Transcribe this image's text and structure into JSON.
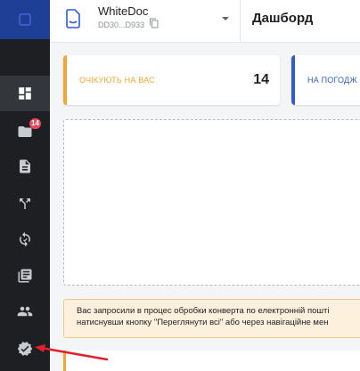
{
  "sidebar": {
    "items": [
      {
        "icon": "dashboard-icon",
        "active": true
      },
      {
        "icon": "folder-icon",
        "badge": "14"
      },
      {
        "icon": "document-icon"
      },
      {
        "icon": "route-icon"
      },
      {
        "icon": "sync-icon"
      },
      {
        "icon": "library-icon"
      },
      {
        "icon": "people-icon"
      },
      {
        "icon": "verified-settings-icon"
      }
    ]
  },
  "header": {
    "doc_name": "WhiteDoc",
    "doc_id": "DD30...D933",
    "page_title": "Дашборд"
  },
  "cards": {
    "waiting_label": "ОЧІКУЮТЬ НА ВАС",
    "waiting_count": "14",
    "approve_label": "НА ПОГОДЖ"
  },
  "notice": {
    "line1": "Вас запросили в процес обробки конверта по електронній пошті",
    "line2": "натиснувши кнопку \"Переглянути всі\" або через навігаційне мен"
  },
  "colors": {
    "sidebar_bg": "#1d1f22",
    "accent_orange": "#f2a633",
    "accent_blue": "#2f5bd3",
    "badge_red": "#e84a5f",
    "annotation_red": "#e0202a"
  }
}
